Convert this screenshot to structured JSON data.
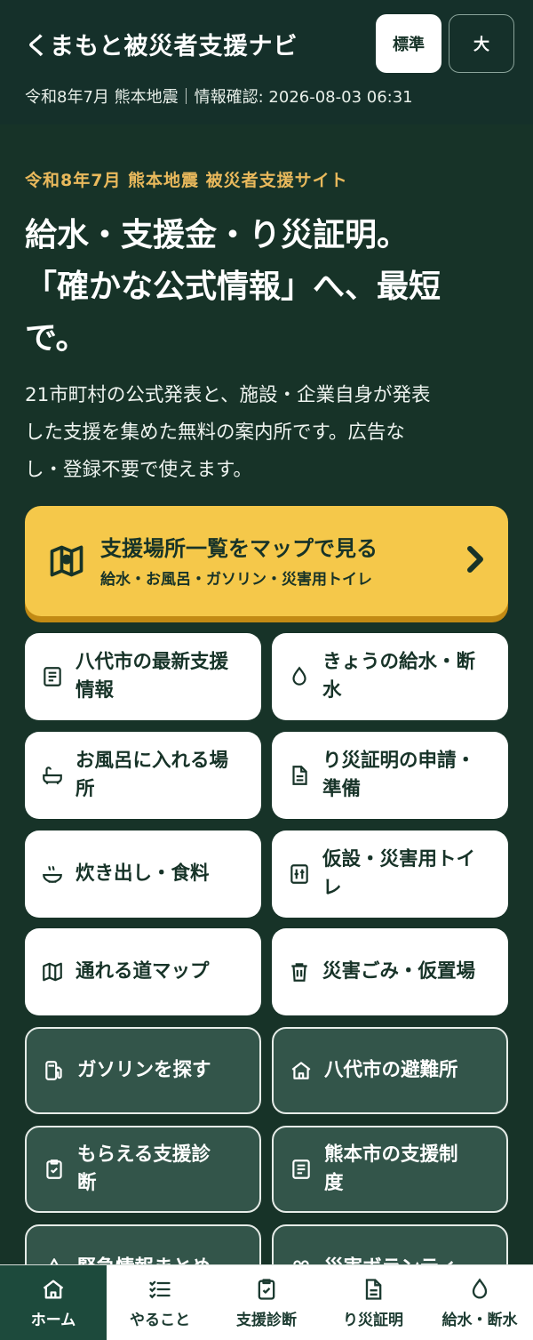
{
  "header": {
    "title": "くまもと被災者支援ナビ",
    "size_standard": "標準",
    "size_large": "大",
    "subline": "令和8年7月 熊本地震｜情報確認: 2026-08-03 06:31"
  },
  "hero": {
    "eyebrow": "令和8年7月 熊本地震 被災者支援サイト",
    "title_line1": "給水・支援金・り災証明。",
    "title_line2": "「確かな公式情報」へ、最短",
    "title_line3": "で。",
    "desc_line1": "21市町村の公式発表と、施設・企業自身が発表",
    "desc_line2": "した支援を集めた無料の案内所です。広告な",
    "desc_line3": "し・登録不要で使えます。"
  },
  "map_cta": {
    "title": "支援場所一覧をマップで見る",
    "subtitle": "給水・お風呂・ガソリン・災害用トイレ"
  },
  "tiles": [
    {
      "label_1": "八代市の最新支援",
      "label_2": "情報",
      "icon": "document-icon"
    },
    {
      "label_1": "きょうの給水・断",
      "label_2": "水",
      "icon": "water-drop-icon"
    },
    {
      "label_1": "お風呂に入れる場",
      "label_2": "所",
      "icon": "bathtub-icon"
    },
    {
      "label_1": "り災証明の申請・",
      "label_2": "準備",
      "icon": "file-icon"
    },
    {
      "label_1": "炊き出し・食料",
      "label_2": "",
      "icon": "food-bowl-icon"
    },
    {
      "label_1": "仮設・災害用トイ",
      "label_2": "レ",
      "icon": "toilet-icon"
    },
    {
      "label_1": "通れる道マップ",
      "label_2": "",
      "icon": "map-icon"
    },
    {
      "label_1": "災害ごみ・仮置場",
      "label_2": "",
      "icon": "trash-icon"
    },
    {
      "label_1": "ガソリンを探す",
      "label_2": "",
      "icon": "fuel-icon"
    },
    {
      "label_1": "八代市の避難所",
      "label_2": "",
      "icon": "home-icon"
    },
    {
      "label_1": "もらえる支援診",
      "label_2": "断",
      "icon": "clipboard-check-icon"
    },
    {
      "label_1": "熊本市の支援制",
      "label_2": "度",
      "icon": "document-icon"
    },
    {
      "label_1": "緊急情報まとめ",
      "label_2": "",
      "icon": "alert-icon"
    },
    {
      "label_1": "災害ボランティ",
      "label_2": "",
      "icon": "people-icon"
    }
  ],
  "nav": {
    "items": [
      {
        "label": "ホーム",
        "icon": "home-icon"
      },
      {
        "label": "やること",
        "icon": "checklist-icon"
      },
      {
        "label": "支援診断",
        "icon": "clipboard-check-icon"
      },
      {
        "label": "り災証明",
        "icon": "file-icon"
      },
      {
        "label": "給水・断水",
        "icon": "water-drop-icon"
      }
    ]
  },
  "colors": {
    "background": "#173328",
    "accent_yellow": "#f5c84a",
    "eyebrow": "#e9b95c",
    "dark_tile": "#33554a"
  }
}
